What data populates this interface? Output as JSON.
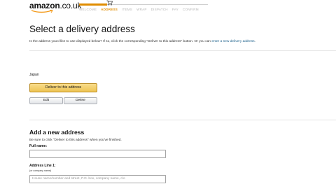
{
  "header": {
    "logo_text": "amazon",
    "logo_tld": ".co.uk",
    "steps": [
      {
        "label": "WELCOME",
        "state": "done"
      },
      {
        "label": "ADDRESS",
        "state": "active"
      },
      {
        "label": "ITEMS",
        "state": "todo"
      },
      {
        "label": "WRAP",
        "state": "todo"
      },
      {
        "label": "DISPATCH",
        "state": "todo"
      },
      {
        "label": "PAY",
        "state": "todo"
      },
      {
        "label": "CONFIRM",
        "state": "todo"
      }
    ],
    "accent_color": "#e08c00"
  },
  "page": {
    "title": "Select a delivery address",
    "intro_text": "Is the address you'd like to use displayed below? If so, click the corresponding \"Deliver to this address\" button. Or you can",
    "intro_link": "enter a new delivery address",
    "intro_end": "."
  },
  "address": {
    "line": "Japan",
    "deliver_label": "Deliver to this address",
    "edit_label": "Edit",
    "delete_label": "Delete"
  },
  "new_address": {
    "title": "Add a new address",
    "hint": "Be sure to click \"Deliver to this address\" when you've finished.",
    "full_name_label": "Full name:",
    "full_name_value": "",
    "line1_label": "Address Line 1:",
    "line1_sublabel": "(or company name)",
    "line1_placeholder": "House name/number and street, P.O. box, company name, c/o"
  }
}
